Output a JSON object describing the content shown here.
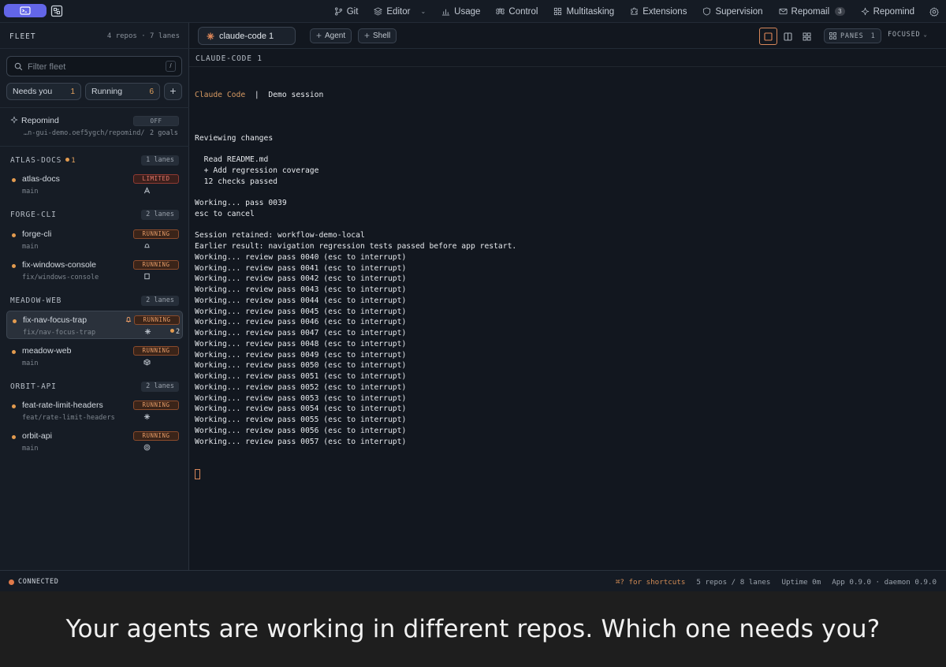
{
  "topbar": {
    "nav": [
      {
        "label": "Git",
        "icon": "git-branch-icon"
      },
      {
        "label": "Editor",
        "icon": "layers-icon"
      },
      {
        "label": "Usage",
        "icon": "bar-chart-icon"
      },
      {
        "label": "Control",
        "icon": "command-icon"
      },
      {
        "label": "Multitasking",
        "icon": "grid-icon"
      },
      {
        "label": "Extensions",
        "icon": "puzzle-icon"
      },
      {
        "label": "Supervision",
        "icon": "shield-icon"
      },
      {
        "label": "Repomail",
        "icon": "mail-icon",
        "badge": "3"
      },
      {
        "label": "Repomind",
        "icon": "sparkle-icon"
      }
    ]
  },
  "sidebar": {
    "title": "FLEET",
    "stats": "4 repos · 7 lanes",
    "filter_placeholder": "Filter fleet",
    "filter_shortcut": "/",
    "chips": [
      {
        "label": "Needs you",
        "count": "1"
      },
      {
        "label": "Running",
        "count": "6"
      }
    ],
    "repomind": {
      "name": "Repomind",
      "toggle": "OFF",
      "path": "…n-gui-demo.oef5ygch/repomind/",
      "goals": "2 goals"
    },
    "groups": [
      {
        "name": "ATLAS-DOCS",
        "count": "1",
        "lanes": "1 lanes"
      },
      {
        "name": "FORGE-CLI",
        "lanes": "2 lanes"
      },
      {
        "name": "MEADOW-WEB",
        "lanes": "2 lanes"
      },
      {
        "name": "ORBIT-API",
        "lanes": "2 lanes"
      }
    ],
    "lanes": [
      {
        "name": "atlas-docs",
        "branch": "main",
        "status": "LIMITED"
      },
      {
        "name": "forge-cli",
        "branch": "main",
        "status": "RUNNING"
      },
      {
        "name": "fix-windows-console",
        "branch": "fix/windows-console",
        "status": "RUNNING"
      },
      {
        "name": "fix-nav-focus-trap",
        "branch": "fix/nav-focus-trap",
        "status": "RUNNING",
        "notifications": "2"
      },
      {
        "name": "meadow-web",
        "branch": "main",
        "status": "RUNNING"
      },
      {
        "name": "feat-rate-limit-headers",
        "branch": "feat/rate-limit-headers",
        "status": "RUNNING"
      },
      {
        "name": "orbit-api",
        "branch": "main",
        "status": "RUNNING"
      }
    ]
  },
  "main": {
    "active_tab": "claude-code 1",
    "agent_button": "Agent",
    "shell_button": "Shell",
    "panes_label": "PANES",
    "panes_count": "1",
    "view_mode": "FOCUSED",
    "pane_title": "CLAUDE-CODE 1"
  },
  "terminal": {
    "header_app": "Claude Code",
    "header_sep": "|",
    "header_session": "Demo session",
    "lines": [
      "",
      "Reviewing changes",
      "",
      "  Read README.md",
      "  + Add regression coverage",
      "  12 checks passed",
      "",
      "Working... pass 0039",
      "esc to cancel",
      "",
      "Session retained: workflow-demo-local",
      "Earlier result: navigation regression tests passed before app restart.",
      "Working... review pass 0040 (esc to interrupt)",
      "Working... review pass 0041 (esc to interrupt)",
      "Working... review pass 0042 (esc to interrupt)",
      "Working... review pass 0043 (esc to interrupt)",
      "Working... review pass 0044 (esc to interrupt)",
      "Working... review pass 0045 (esc to interrupt)",
      "Working... review pass 0046 (esc to interrupt)",
      "Working... review pass 0047 (esc to interrupt)",
      "Working... review pass 0048 (esc to interrupt)",
      "Working... review pass 0049 (esc to interrupt)",
      "Working... review pass 0050 (esc to interrupt)",
      "Working... review pass 0051 (esc to interrupt)",
      "Working... review pass 0052 (esc to interrupt)",
      "Working... review pass 0053 (esc to interrupt)",
      "Working... review pass 0054 (esc to interrupt)",
      "Working... review pass 0055 (esc to interrupt)",
      "Working... review pass 0056 (esc to interrupt)",
      "Working... review pass 0057 (esc to interrupt)"
    ]
  },
  "statusbar": {
    "connection": "CONNECTED",
    "shortcuts": "⌘? for shortcuts",
    "counts": "5 repos / 8 lanes",
    "uptime": "Uptime 0m",
    "version": "App 0.9.0 · daemon 0.9.0"
  },
  "caption": "Your agents are working in different repos. Which one needs you?",
  "colors": {
    "accent": "#e39b4f",
    "brand": "#6366e8",
    "running": "#e59a66",
    "limited": "#e6776a"
  }
}
